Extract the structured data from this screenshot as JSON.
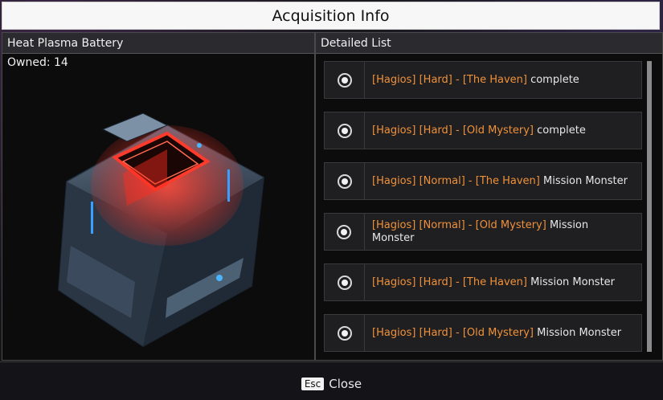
{
  "modal": {
    "title": "Acquisition Info"
  },
  "item_panel": {
    "name": "Heat Plasma Battery",
    "owned_label": "Owned: 14",
    "image_icon": "plasma-battery-icon"
  },
  "list_panel": {
    "header": "Detailed List",
    "items": [
      {
        "highlight": "[Hagios] [Hard] - [The Haven]",
        "suffix": " complete"
      },
      {
        "highlight": "[Hagios] [Hard] - [Old Mystery]",
        "suffix": " complete"
      },
      {
        "highlight": "[Hagios] [Normal] - [The Haven]",
        "suffix": " Mission Monster"
      },
      {
        "highlight": "[Hagios] [Normal] - [Old Mystery]",
        "suffix": " Mission Monster"
      },
      {
        "highlight": "[Hagios] [Hard] - [The Haven]",
        "suffix": " Mission Monster"
      },
      {
        "highlight": "[Hagios] [Hard] - [Old Mystery]",
        "suffix": " Mission Monster"
      }
    ]
  },
  "footer": {
    "key": "Esc",
    "label": "Close"
  },
  "colors": {
    "highlight": "#f0913a",
    "title_bg": "#f7f7f7",
    "panel_bg": "#0c0c0d"
  }
}
